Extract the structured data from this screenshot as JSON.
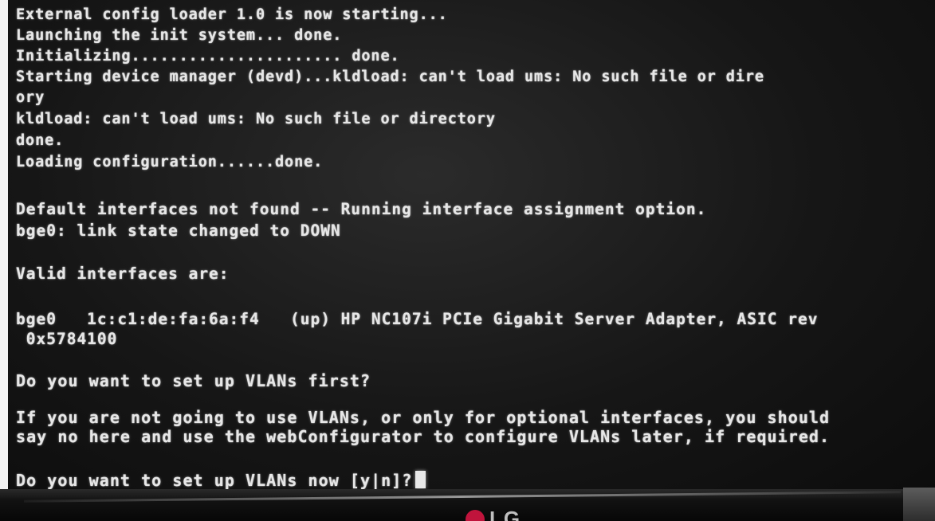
{
  "console": {
    "lines": [
      "External config loader 1.0 is now starting...",
      "Launching the init system... done.",
      "Initializing...................... done.",
      "Starting device manager (devd)...kldload: can't load ums: No such file or dire",
      "ory",
      "kldload: can't load ums: No such file or directory",
      "done.",
      "Loading configuration......done.",
      "Default interfaces not found -- Running interface assignment option.",
      "bge0: link state changed to DOWN",
      "Valid interfaces are:",
      "bge0   1c:c1:de:fa:6a:f4   (up) HP NC107i PCIe Gigabit Server Adapter, ASIC rev",
      " 0x5784100",
      "Do you want to set up VLANs first?",
      "If you are not going to use VLANs, or only for optional interfaces, you should",
      "say no here and use the webConfigurator to configure VLANs later, if required.",
      "Do you want to set up VLANs now [y|n]?"
    ]
  },
  "monitor": {
    "brand": "LG",
    "brand_color": "#c0143c"
  }
}
